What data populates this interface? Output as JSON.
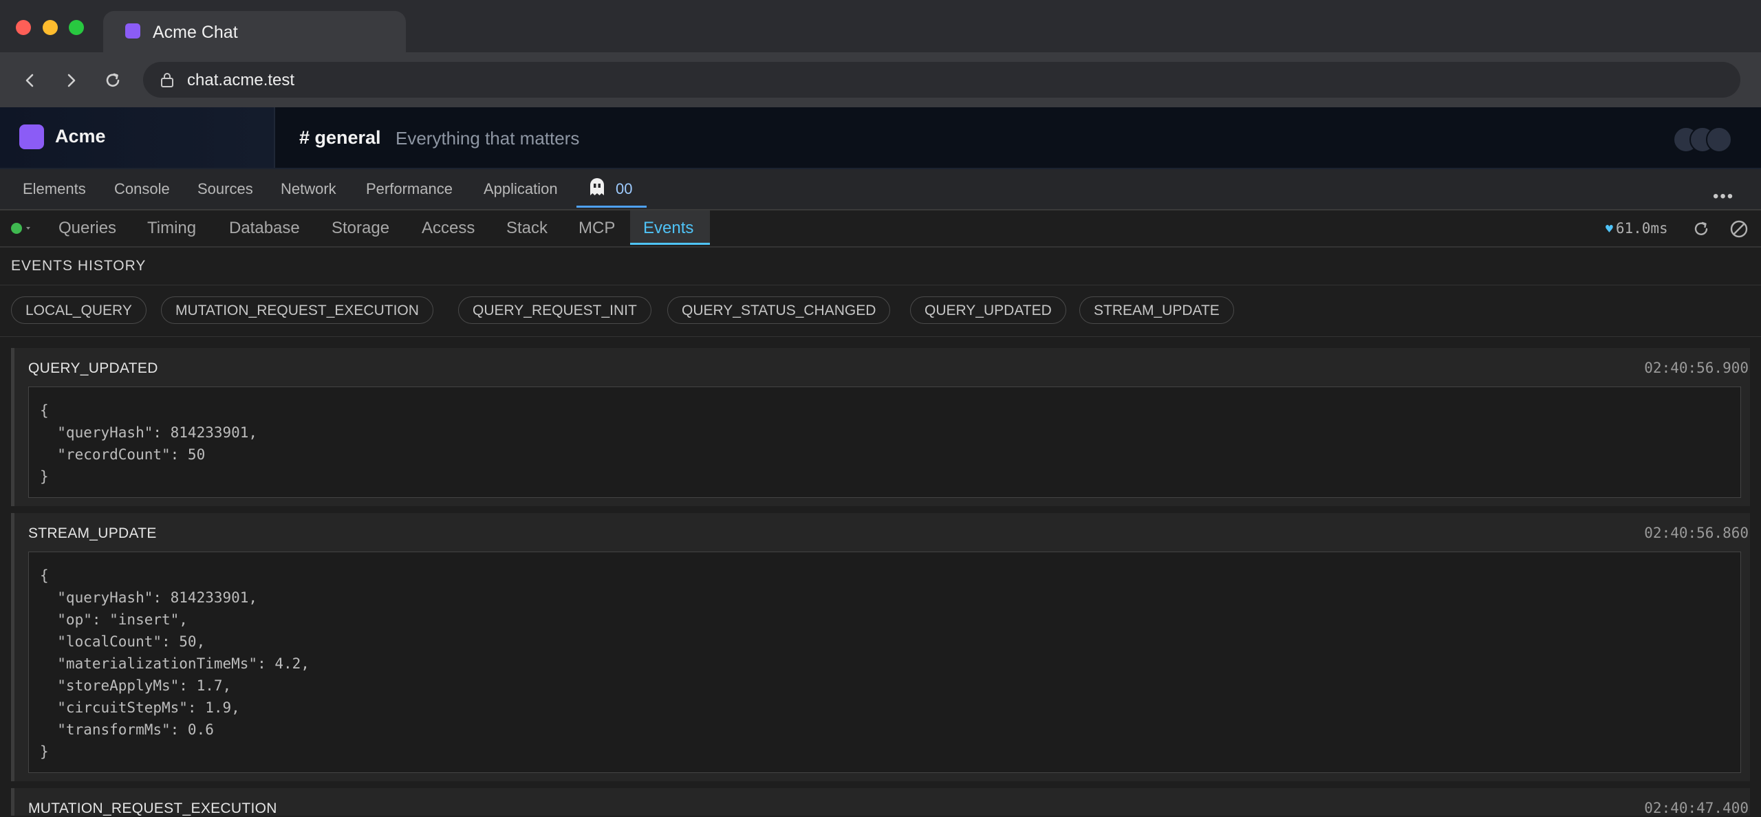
{
  "browser": {
    "tab_title": "Acme Chat",
    "url": "chat.acme.test"
  },
  "app": {
    "workspace_name": "Acme",
    "channel": "# general",
    "channel_description": "Everything that matters"
  },
  "devtools": {
    "tabs": [
      "Elements",
      "Console",
      "Sources",
      "Network",
      "Performance",
      "Application"
    ],
    "active_tab_label": "00",
    "more_label": "•••"
  },
  "plugin": {
    "tabs": [
      "Queries",
      "Timing",
      "Database",
      "Storage",
      "Access",
      "Stack",
      "MCP",
      "Events"
    ],
    "active_tab": "Events",
    "perf_value": "61.0ms",
    "status_color": "#3fb950"
  },
  "events": {
    "title": "EVENTS HISTORY",
    "filters": [
      "LOCAL_QUERY",
      "MUTATION_REQUEST_EXECUTION",
      "QUERY_REQUEST_INIT",
      "QUERY_STATUS_CHANGED",
      "QUERY_UPDATED",
      "STREAM_UPDATE"
    ],
    "items": [
      {
        "name": "QUERY_UPDATED",
        "time": "02:40:56.900",
        "payload": "{\n  \"queryHash\": 814233901,\n  \"recordCount\": 50\n}"
      },
      {
        "name": "STREAM_UPDATE",
        "time": "02:40:56.860",
        "payload": "{\n  \"queryHash\": 814233901,\n  \"op\": \"insert\",\n  \"localCount\": 50,\n  \"materializationTimeMs\": 4.2,\n  \"storeApplyMs\": 1.7,\n  \"circuitStepMs\": 1.9,\n  \"transformMs\": 0.6\n}"
      },
      {
        "name": "MUTATION_REQUEST_EXECUTION",
        "time": "02:40:47.400",
        "payload": ""
      }
    ]
  }
}
